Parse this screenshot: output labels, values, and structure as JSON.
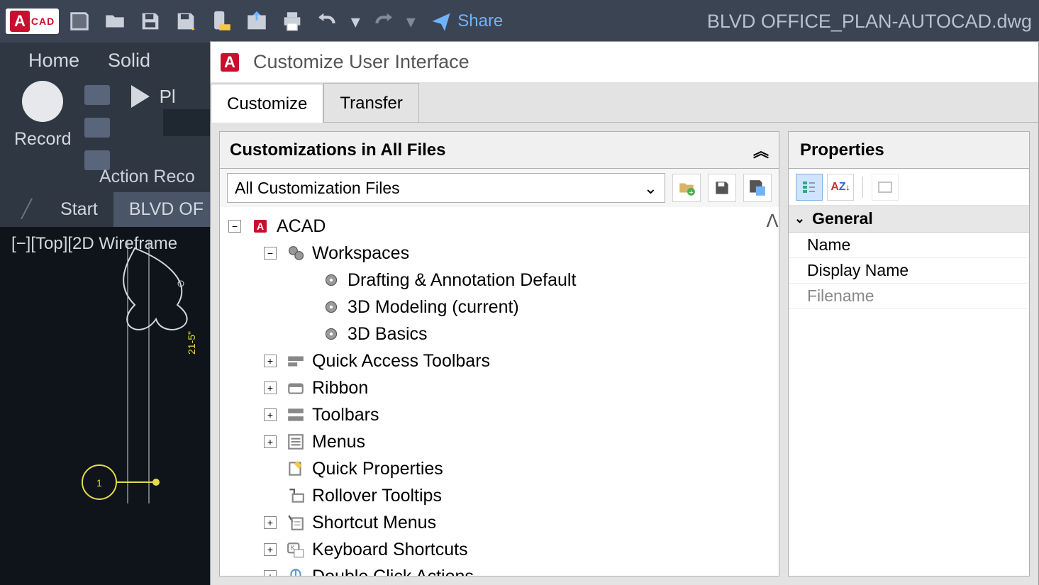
{
  "app": {
    "letter": "A",
    "suffix": "CAD"
  },
  "titlebar": {
    "share": "Share",
    "filename": "BLVD OFFICE_PLAN-AUTOCAD.dwg"
  },
  "ribbon": {
    "tabs": [
      "Home",
      "Solid"
    ]
  },
  "record": {
    "label": "Record",
    "play": "Pl",
    "panel_label": "Action Reco"
  },
  "filetabs": {
    "start": "Start",
    "active": "BLVD OF"
  },
  "viewport": {
    "label": "[−][Top][2D Wireframe"
  },
  "popup": {
    "title": "Customize User Interface",
    "tabs": {
      "customize": "Customize",
      "transfer": "Transfer"
    },
    "left": {
      "header": "Customizations in All Files",
      "dropdown": "All Customization Files",
      "tree": {
        "root": "ACAD",
        "workspaces": {
          "label": "Workspaces",
          "items": [
            "Drafting & Annotation Default",
            "3D Modeling (current)",
            "3D Basics"
          ]
        },
        "nodes": [
          "Quick Access Toolbars",
          "Ribbon",
          "Toolbars",
          "Menus",
          "Quick Properties",
          "Rollover Tooltips",
          "Shortcut Menus",
          "Keyboard Shortcuts",
          "Double Click Actions"
        ]
      }
    },
    "right": {
      "header": "Properties",
      "group": "General",
      "rows": {
        "name": "Name",
        "display_name": "Display Name",
        "filename": "Filename"
      }
    }
  }
}
